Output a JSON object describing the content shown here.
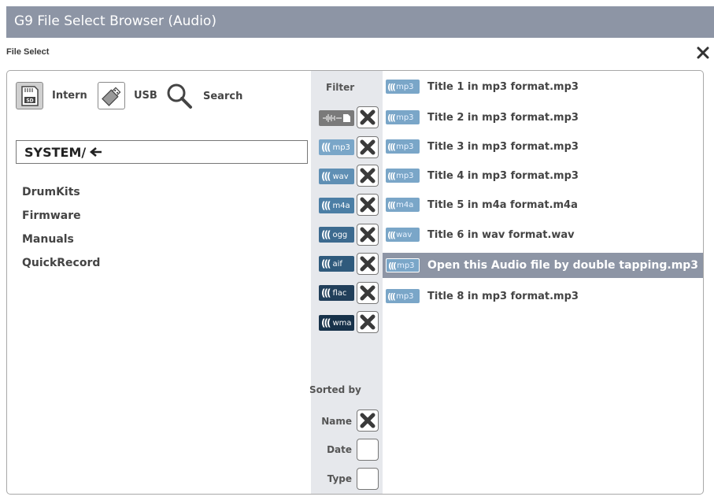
{
  "window": {
    "title": "G9 File Select Browser (Audio)"
  },
  "dialog": {
    "subtitle": "File Select",
    "close_icon": "close-icon"
  },
  "sources": [
    {
      "label": "Intern",
      "icon": "sd-card-icon",
      "active": true
    },
    {
      "label": "USB",
      "icon": "usb-stick-icon",
      "active": false
    },
    {
      "label": "Search",
      "icon": "search-icon",
      "active": false
    }
  ],
  "path": {
    "value": "SYSTEM/",
    "back_icon": "back-arrow-icon"
  },
  "folders": [
    "DrumKits",
    "Firmware",
    "Manuals",
    "QuickRecord"
  ],
  "filter": {
    "title": "Filter",
    "items": [
      {
        "label": "",
        "icon": "waveform-all-icon",
        "color": "#7a7a7a",
        "checked": true
      },
      {
        "label": "mp3",
        "color": "#7aa6c8",
        "checked": true
      },
      {
        "label": "wav",
        "color": "#5f8fb4",
        "checked": true
      },
      {
        "label": "m4a",
        "color": "#4b7ea5",
        "checked": true
      },
      {
        "label": "ogg",
        "color": "#3c6a8f",
        "checked": true
      },
      {
        "label": "aif",
        "color": "#2f5a7c",
        "checked": true
      },
      {
        "label": "flac",
        "color": "#213f5a",
        "checked": true
      },
      {
        "label": "wma",
        "color": "#17324a",
        "checked": true
      }
    ]
  },
  "sort": {
    "title": "Sorted by",
    "options": [
      {
        "label": "Name",
        "checked": true
      },
      {
        "label": "Date",
        "checked": false
      },
      {
        "label": "Type",
        "checked": false
      }
    ]
  },
  "files": [
    {
      "name": "Title 1 in mp3 format.mp3",
      "ext": "mp3",
      "selected": false
    },
    {
      "name": "Title 2 in mp3 format.mp3",
      "ext": "mp3",
      "selected": false
    },
    {
      "name": "Title 3 in mp3 format.mp3",
      "ext": "mp3",
      "selected": false
    },
    {
      "name": "Title 4 in mp3 format.mp3",
      "ext": "mp3",
      "selected": false
    },
    {
      "name": "Title 5 in m4a format.m4a",
      "ext": "m4a",
      "selected": false
    },
    {
      "name": "Title 6 in wav format.wav",
      "ext": "wav",
      "selected": false
    },
    {
      "name": "Open this Audio file by double tapping.mp3",
      "ext": "mp3",
      "selected": true
    },
    {
      "name": "Title 8 in mp3 format.mp3",
      "ext": "mp3",
      "selected": false
    }
  ],
  "colors": {
    "titlebar": "#8d95a5",
    "selected_row": "#8d95a5",
    "filter_bg": "#e6e8ec"
  }
}
